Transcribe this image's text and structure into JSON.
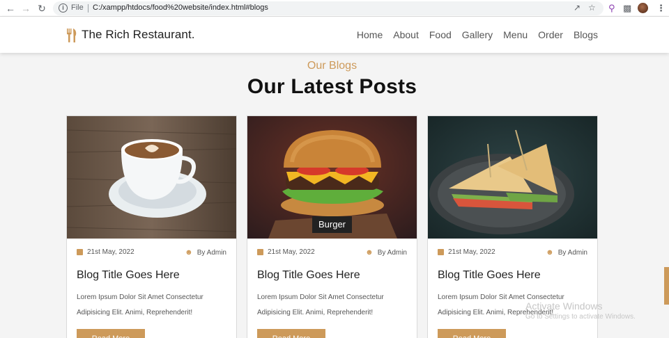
{
  "browser": {
    "file_label": "File",
    "url": "C:/xampp/htdocs/food%20website/index.html#blogs"
  },
  "site": {
    "logo_text": "The Rich Restaurant.",
    "nav": [
      "Home",
      "About",
      "Food",
      "Gallery",
      "Menu",
      "Order",
      "Blogs"
    ]
  },
  "section": {
    "eyebrow": "Our Blogs",
    "title": "Our Latest Posts"
  },
  "cards": [
    {
      "image": "coffee-cup",
      "tag": "",
      "date": "21st May, 2022",
      "author": "By Admin",
      "title": "Blog Title Goes Here",
      "text_1": "Lorem Ipsum Dolor Sit Amet Consectetur",
      "text_2": "Adipisicing Elit. Animi, Reprehenderit!",
      "button": "Read More"
    },
    {
      "image": "burger",
      "tag": "Burger",
      "date": "21st May, 2022",
      "author": "By Admin",
      "title": "Blog Title Goes Here",
      "text_1": "Lorem Ipsum Dolor Sit Amet Consectetur",
      "text_2": "Adipisicing Elit. Animi, Reprehenderit!",
      "button": "Read More"
    },
    {
      "image": "sandwich",
      "tag": "",
      "date": "21st May, 2022",
      "author": "By Admin",
      "title": "Blog Title Goes Here",
      "text_1": "Lorem Ipsum Dolor Sit Amet Consectetur",
      "text_2": "Adipisicing Elit. Animi, Reprehenderit!",
      "button": "Read More"
    }
  ],
  "watermark": {
    "title": "Activate Windows",
    "subtitle": "Go to Settings to activate Windows."
  },
  "colors": {
    "accent": "#cd9a5a",
    "background": "#f4f4f4"
  }
}
